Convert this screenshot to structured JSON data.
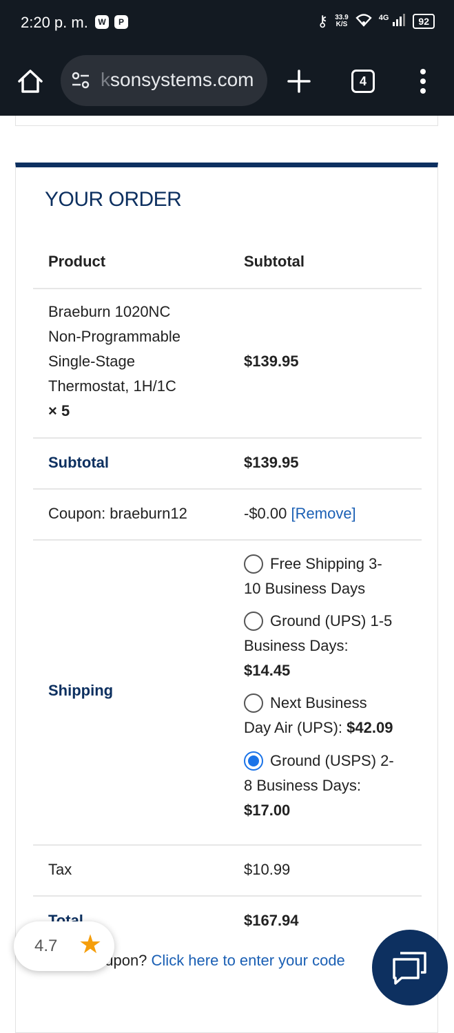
{
  "status_bar": {
    "time": "2:20 p. m.",
    "net_speed_value": "33.9",
    "net_speed_unit": "K/S",
    "network": "4G",
    "battery": "92"
  },
  "browser": {
    "url_partial": "sonsystems.com",
    "url_faded": "k",
    "tab_count": "4"
  },
  "order": {
    "title": "YOUR ORDER",
    "headers": {
      "product": "Product",
      "subtotal": "Subtotal"
    },
    "item": {
      "name_lines": [
        "Braeburn 1020NC",
        "Non-Programmable",
        "Single-Stage",
        "Thermostat, 1H/1C"
      ],
      "quantity": "× 5",
      "price": "$139.95"
    },
    "subtotal": {
      "label": "Subtotal",
      "value": "$139.95"
    },
    "coupon": {
      "label": "Coupon: braeburn12",
      "value": "-$0.00",
      "remove": "[Remove]"
    },
    "shipping": {
      "label": "Shipping",
      "options": [
        {
          "lines": [
            "Free Shipping 3-",
            "10 Business Days"
          ],
          "price": "",
          "checked": false
        },
        {
          "lines": [
            "Ground (UPS) 1-5",
            "Business Days:"
          ],
          "price": "$14.45",
          "checked": false
        },
        {
          "lines": [
            "Next Business",
            "Day Air (UPS): "
          ],
          "price": "$42.09",
          "checked": false
        },
        {
          "lines": [
            "Ground (USPS) 2-",
            "8 Business Days:"
          ],
          "price": "$17.00",
          "checked": true
        }
      ]
    },
    "tax": {
      "label": "Tax",
      "value": "$10.99"
    },
    "total": {
      "label": "Total",
      "value": "$167.94"
    }
  },
  "coupon_prompt": {
    "text": "oupon? ",
    "link": "Click here to enter your code"
  },
  "rating_widget": {
    "value": "4.7",
    "icon": "star-icon"
  },
  "chat_widget": {
    "icon": "chat-icon"
  }
}
